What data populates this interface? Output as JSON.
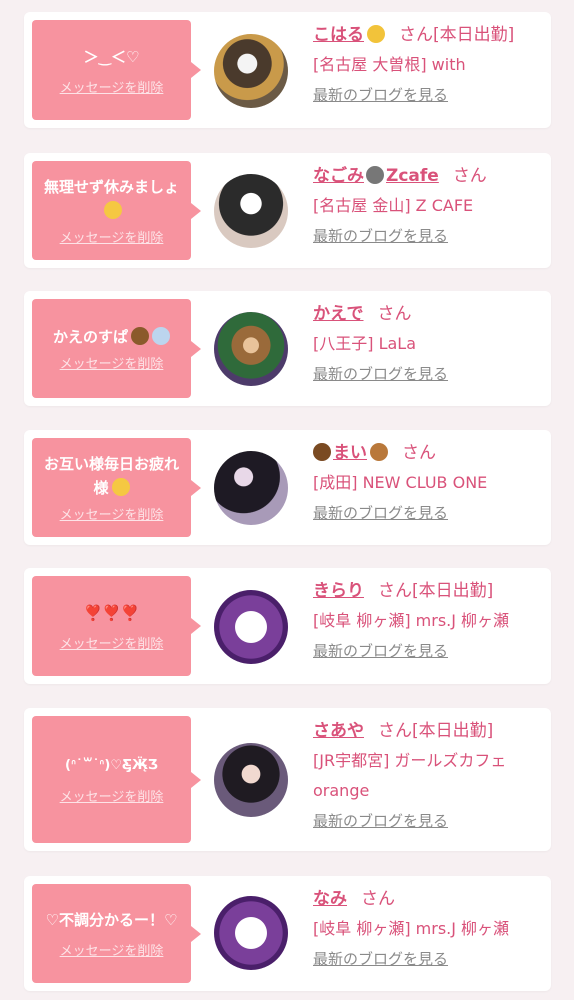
{
  "labels": {
    "delete": "メッセージを削除",
    "blog": "最新のブログを見る",
    "san": "さん"
  },
  "items": [
    {
      "message": "＞‿＜♡",
      "name": "こはる",
      "status": "[本日出勤]",
      "shop": "[名古屋 大曽根] with"
    },
    {
      "message": "無理せず休みましょ",
      "name": "なごみ",
      "name_suffix": "Zcafe",
      "status": "",
      "shop": "[名古屋 金山] Z CAFE"
    },
    {
      "message": "かえのすぱ",
      "name": "かえで",
      "status": "",
      "shop": "[八王子] LaLa"
    },
    {
      "message": "お互い様毎日お疲れ様",
      "name": "まい",
      "status": "",
      "shop": "[成田] NEW CLUB ONE"
    },
    {
      "message": "❣️❣️❣️",
      "name": "きらり",
      "status": "[本日出勤]",
      "shop": "[岐阜 柳ヶ瀬] mrs.J 柳ヶ瀬"
    },
    {
      "message": "(ᐢ˙꒳˙ᐢ)♡Ƹ̵̡Ӝ̵̨̄Ʒ",
      "name": "さあや",
      "status": "[本日出勤]",
      "shop": "[JR宇都宮] ガールズカフェ orange"
    },
    {
      "message": "♡不調分かるー！♡",
      "name": "なみ",
      "status": "",
      "shop": "[岐阜 柳ヶ瀬] mrs.J 柳ヶ瀬"
    }
  ],
  "colors": {
    "accent": "#d9527a",
    "bubble": "#f7939f",
    "muted": "#8a8a8a"
  }
}
